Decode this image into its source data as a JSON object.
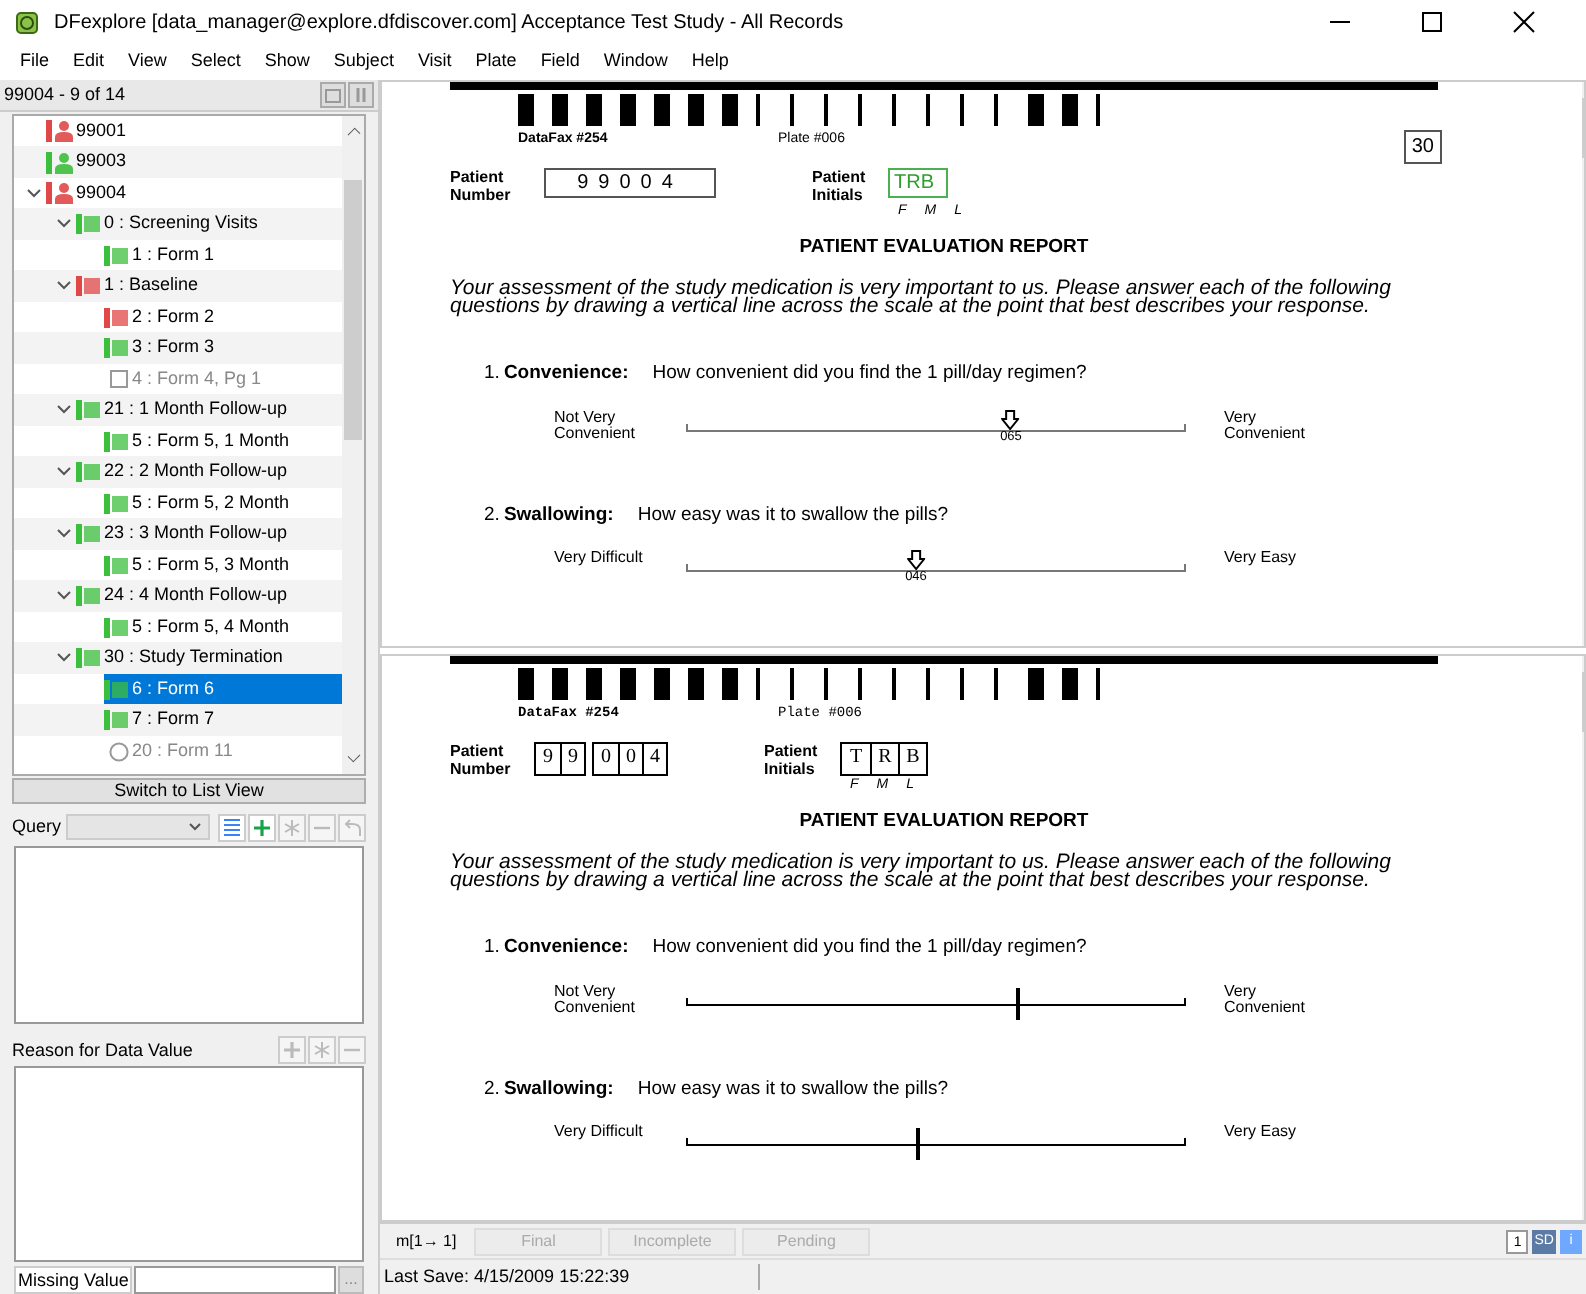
{
  "window": {
    "title": "DFexplore [data_manager@explore.dfdiscover.com] Acceptance Test Study - All Records"
  },
  "menu": [
    "File",
    "Edit",
    "View",
    "Select",
    "Show",
    "Subject",
    "Visit",
    "Plate",
    "Field",
    "Window",
    "Help"
  ],
  "navigator": {
    "header": "99004 - 9 of 14",
    "switch_button": "Switch to List View",
    "tree": [
      {
        "label": "99001",
        "kind": "subject",
        "color": "#e04848",
        "selected": false
      },
      {
        "label": "99003",
        "kind": "subject",
        "color": "#3cbf3c",
        "selected": false
      },
      {
        "label": "99004",
        "kind": "subject",
        "color": "#e04848",
        "expanded": true,
        "selected": false,
        "children": [
          {
            "label": "0 : Screening Visits",
            "kind": "visit",
            "color": "#3cbf3c",
            "expanded": true,
            "selected": false,
            "children": [
              {
                "label": "1 : Form 1",
                "kind": "form",
                "color": "#3cbf3c",
                "selected": false
              }
            ]
          },
          {
            "label": "1 : Baseline",
            "kind": "visit",
            "color": "#e04848",
            "expanded": true,
            "selected": false,
            "children": [
              {
                "label": "2 : Form 2",
                "kind": "form",
                "color": "#e04848",
                "selected": false
              },
              {
                "label": "3 : Form 3",
                "kind": "form",
                "color": "#3cbf3c",
                "selected": false
              },
              {
                "label": "4 : Form 4, Pg 1",
                "kind": "missing_form",
                "selected": false
              }
            ]
          },
          {
            "label": "21 : 1 Month Follow-up",
            "kind": "visit",
            "color": "#3cbf3c",
            "expanded": true,
            "selected": false,
            "children": [
              {
                "label": "5 : Form 5, 1 Month",
                "kind": "form",
                "color": "#3cbf3c",
                "selected": false
              }
            ]
          },
          {
            "label": "22 : 2 Month Follow-up",
            "kind": "visit",
            "color": "#3cbf3c",
            "expanded": true,
            "selected": false,
            "children": [
              {
                "label": "5 : Form 5, 2 Month",
                "kind": "form",
                "color": "#3cbf3c",
                "selected": false
              }
            ]
          },
          {
            "label": "23 : 3 Month Follow-up",
            "kind": "visit",
            "color": "#3cbf3c",
            "expanded": true,
            "selected": false,
            "children": [
              {
                "label": "5 : Form 5, 3 Month",
                "kind": "form",
                "color": "#3cbf3c",
                "selected": false
              }
            ]
          },
          {
            "label": "24 : 4 Month Follow-up",
            "kind": "visit",
            "color": "#3cbf3c",
            "expanded": true,
            "selected": false,
            "children": [
              {
                "label": "5 : Form 5, 4 Month",
                "kind": "form",
                "color": "#3cbf3c",
                "selected": false
              }
            ]
          },
          {
            "label": "30 : Study Termination",
            "kind": "visit",
            "color": "#3cbf3c",
            "expanded": true,
            "selected": false,
            "children": [
              {
                "label": "6 : Form 6",
                "kind": "form",
                "color": "#3cbf3c",
                "selected": true
              },
              {
                "label": "7 : Form 7",
                "kind": "form",
                "color": "#3cbf3c",
                "selected": false
              },
              {
                "label": "20 : Form 11",
                "kind": "optional_form",
                "selected": false
              }
            ]
          }
        ]
      }
    ]
  },
  "query": {
    "label": "Query",
    "tools": [
      {
        "kind": "list",
        "disabled": false
      },
      {
        "kind": "add",
        "disabled": false
      },
      {
        "kind": "edit",
        "disabled": true
      },
      {
        "kind": "remove",
        "disabled": true
      },
      {
        "kind": "undo",
        "disabled": true
      }
    ]
  },
  "reason": {
    "label": "Reason for Data Value",
    "tools": [
      {
        "kind": "add",
        "disabled": true
      },
      {
        "kind": "edit",
        "disabled": true
      },
      {
        "kind": "remove",
        "disabled": true
      }
    ]
  },
  "missing_value": {
    "label": "Missing Value",
    "button": "..."
  },
  "pages": [
    {
      "kind": "entry",
      "datafax": "DataFax #254",
      "plate": "Plate #006",
      "visit_box": "30",
      "number_label": "Patient Number",
      "number": "99004",
      "initials_label": "Patient Initials",
      "initials": "TRB",
      "initials_parts": [
        "F",
        "M",
        "L"
      ],
      "title": "PATIENT EVALUATION REPORT",
      "intro": "Your assessment of the study medication is very important to us. Please answer each of the following questions by drawing a vertical line across the scale at the point that best describes your response.",
      "questions": [
        {
          "number": "1.",
          "label": "Convenience:",
          "text": "How convenient did you find the 1 pill/day regimen?",
          "left": "Not Very Convenient",
          "right": "Very Convenient",
          "level": 0.65,
          "reading": "065"
        },
        {
          "number": "2.",
          "label": "Swallowing:",
          "text": "How easy was it to swallow the pills?",
          "left": "Very Difficult",
          "right": "Very Easy",
          "level": 0.46,
          "reading": "046"
        }
      ]
    },
    {
      "kind": "scan",
      "datafax": "DataFax #254",
      "plate": "Plate #006",
      "number_label": "Patient Number",
      "number_digits": [
        "9",
        "9",
        "0",
        "0",
        "4"
      ],
      "initials_label": "Patient Initials",
      "initials_letters": [
        "T",
        "R",
        "B"
      ],
      "initials_parts": [
        "F",
        "M",
        "L"
      ],
      "title": "PATIENT EVALUATION REPORT",
      "intro": "Your assessment of the study medication is very important to us. Please answer each of the following questions by drawing a vertical line across the scale at the point that best describes your response.",
      "questions": [
        {
          "number": "1.",
          "label": "Convenience:",
          "text": "How convenient did you find the 1 pill/day regimen?",
          "left": "Not Very Convenient",
          "right": "Very Convenient",
          "level": 0.66
        },
        {
          "number": "2.",
          "label": "Swallowing:",
          "text": "How easy was it to swallow the pills?",
          "left": "Very Difficult",
          "right": "Very Easy",
          "level": 0.46
        }
      ]
    }
  ],
  "record_bar": {
    "buttons": [
      {
        "label": "m[1→ 1]",
        "disabled": false
      },
      {
        "label": "Final",
        "disabled": true
      },
      {
        "label": "Incomplete",
        "disabled": true
      },
      {
        "label": "Pending",
        "disabled": true
      }
    ],
    "indicators": [
      "1",
      "SD",
      "i"
    ]
  },
  "status_bar": "Last Save: 4/15/2009 15:22:39"
}
